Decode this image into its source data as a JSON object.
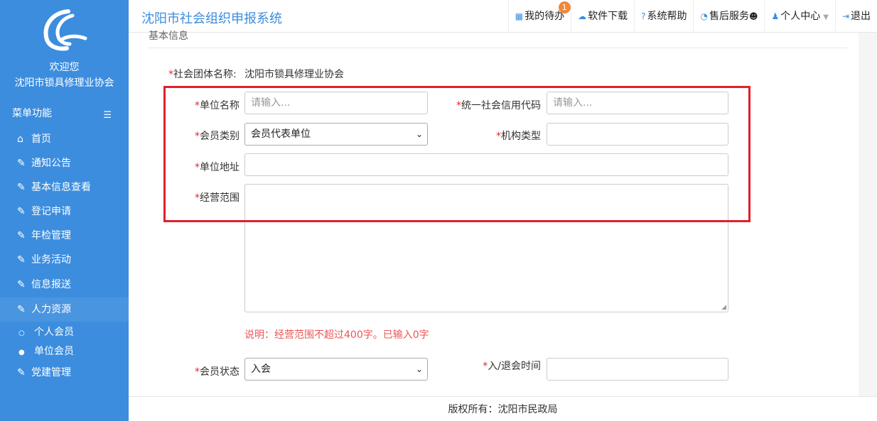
{
  "app_title": "沈阳市社会组织申报系统",
  "sidebar": {
    "welcome": "欢迎您",
    "org_name": "沈阳市锁具修理业协会",
    "menu_header": "菜单功能",
    "items": [
      {
        "label": "首页",
        "icon": "home-icon"
      },
      {
        "label": "通知公告",
        "icon": "edit-icon"
      },
      {
        "label": "基本信息查看",
        "icon": "edit-icon"
      },
      {
        "label": "登记申请",
        "icon": "edit-icon"
      },
      {
        "label": "年检管理",
        "icon": "edit-icon"
      },
      {
        "label": "业务活动",
        "icon": "edit-icon"
      },
      {
        "label": "信息报送",
        "icon": "edit-icon"
      },
      {
        "label": "人力资源",
        "icon": "edit-icon",
        "active": true
      }
    ],
    "sub_items": [
      {
        "label": "个人会员",
        "selected": false
      },
      {
        "label": "单位会员",
        "selected": true
      }
    ],
    "last_item": {
      "label": "党建管理",
      "icon": "edit-icon"
    }
  },
  "topnav": {
    "todo": "我的待办",
    "todo_count": "1",
    "download": "软件下载",
    "help": "系统帮助",
    "service": "售后服务",
    "profile": "个人中心",
    "logout": "退出"
  },
  "form": {
    "section_title": "基本信息",
    "social_group_label": "社会团体名称:",
    "social_group_value": "沈阳市锁具修理业协会",
    "unit_name_label": "单位名称",
    "unit_name_placeholder": "请输入...",
    "credit_code_label": "统一社会信用代码",
    "credit_code_placeholder": "请输入...",
    "member_type_label": "会员类别",
    "member_type_value": "会员代表单位",
    "org_type_label": "机构类型",
    "address_label": "单位地址",
    "scope_label": "经营范围",
    "scope_hint": "说明：经营范围不超过400字。已输入0字",
    "member_status_label": "会员状态",
    "member_status_value": "入会",
    "join_time_label": "入/退会时间"
  },
  "footer": "版权所有：沈阳市民政局",
  "colors": {
    "sidebar": "#3c8dde",
    "accent": "#3c8dde",
    "required": "#e23",
    "highlight_box": "#e0202a"
  }
}
